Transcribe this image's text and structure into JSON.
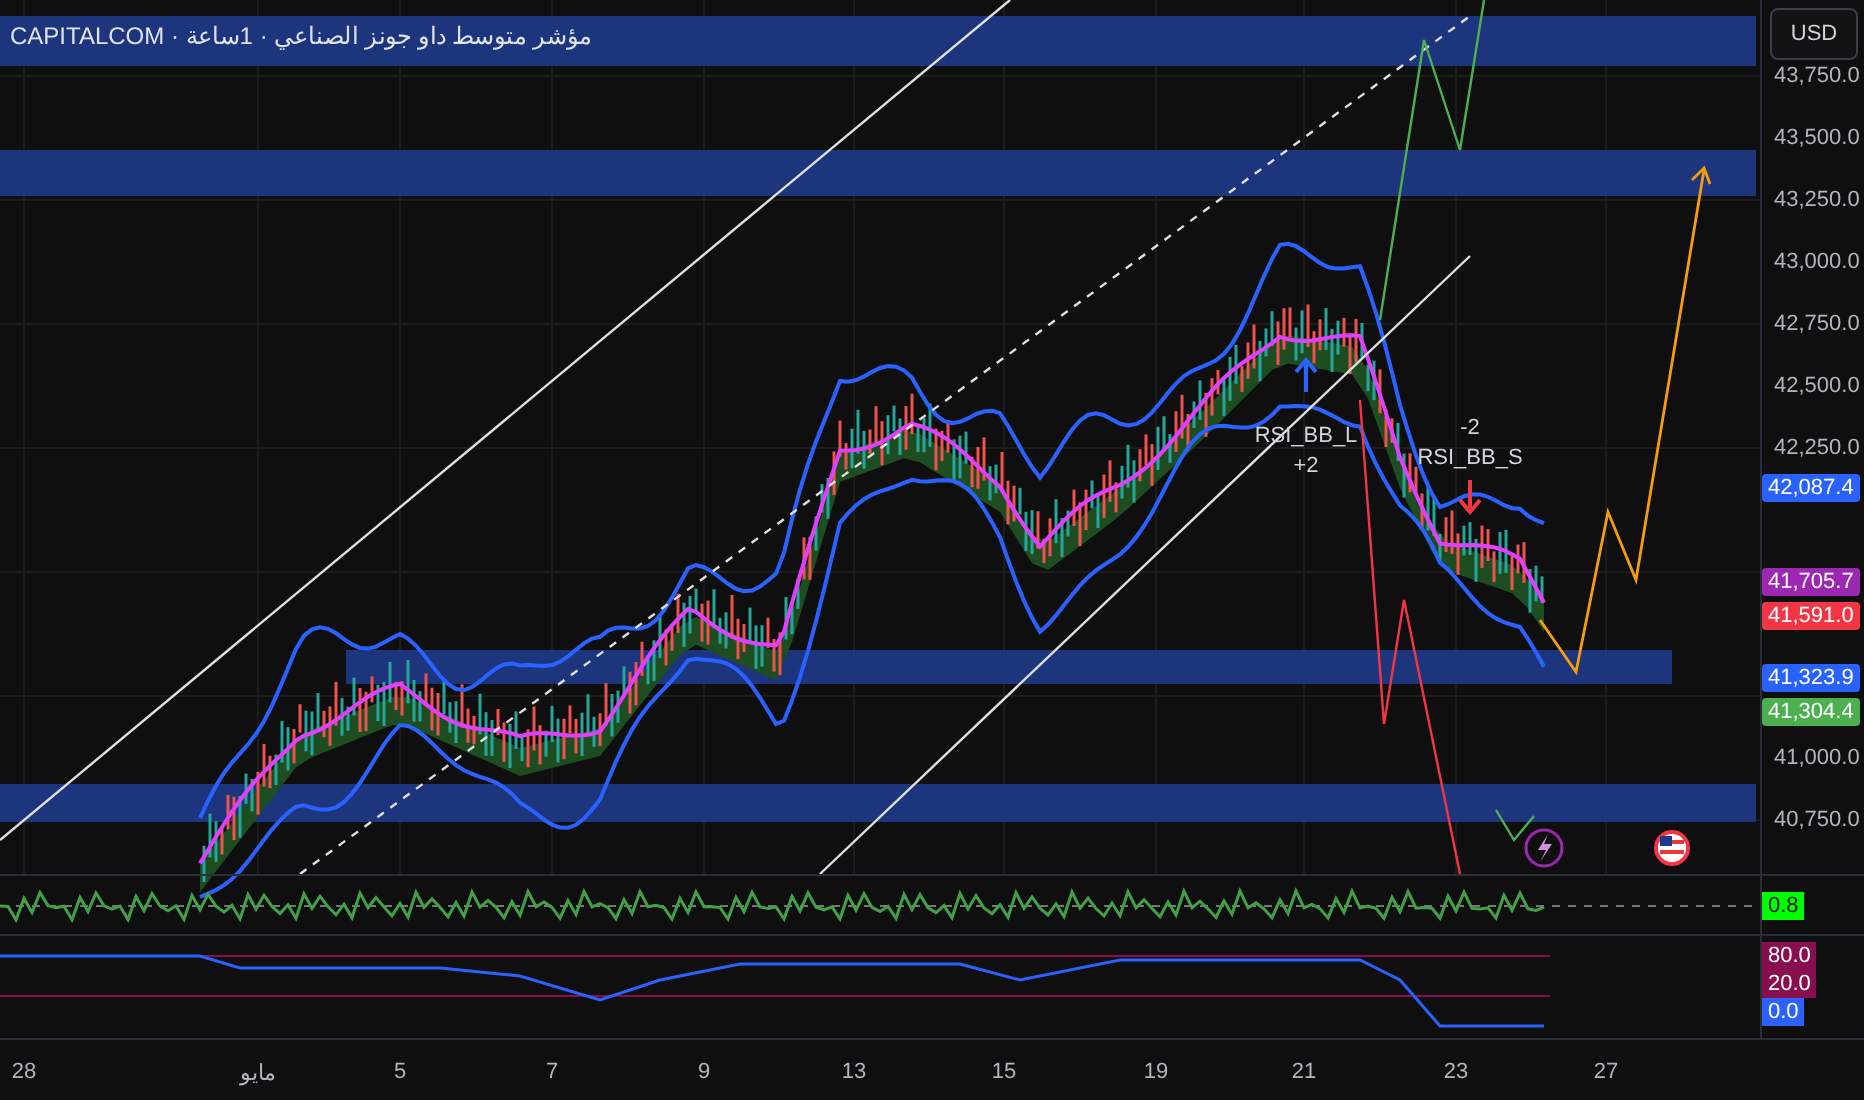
{
  "header": {
    "title": "CAPITALCOM · مؤشر متوسط داو جونز الصناعي · 1ساعة"
  },
  "currency_button": {
    "label": "USD"
  },
  "price_axis": {
    "ticks": [
      "43,750.0",
      "43,500.0",
      "43,250.0",
      "43,000.0",
      "42,750.0",
      "42,500.0",
      "42,250.0",
      "41,000.0",
      "40,750.0"
    ]
  },
  "price_labels": [
    {
      "value": "42,087.4",
      "color": "#2962ff"
    },
    {
      "value": "41,705.7",
      "color": "#9c27b0"
    },
    {
      "value": "41,591.0",
      "color": "#f23645"
    },
    {
      "value": "41,323.9",
      "color": "#2962ff"
    },
    {
      "value": "41,304.4",
      "color": "#4caf50"
    }
  ],
  "signals": [
    {
      "kind": "long",
      "label": "RSI_BB_L",
      "count": "+2"
    },
    {
      "kind": "short",
      "label": "RSI_BB_S",
      "count": "-2"
    }
  ],
  "oscillator_pane": {
    "labels": [
      {
        "value": "0.8",
        "color": "#00ff00"
      }
    ]
  },
  "rsi_pane": {
    "labels": [
      {
        "value": "80.0",
        "color": "#880e4f"
      },
      {
        "value": "20.0",
        "color": "#880e4f"
      },
      {
        "value": "0.0",
        "color": "#2962ff"
      }
    ]
  },
  "time_axis": {
    "labels": [
      "28",
      "مايو",
      "5",
      "7",
      "9",
      "13",
      "15",
      "19",
      "21",
      "23",
      "27"
    ]
  }
}
